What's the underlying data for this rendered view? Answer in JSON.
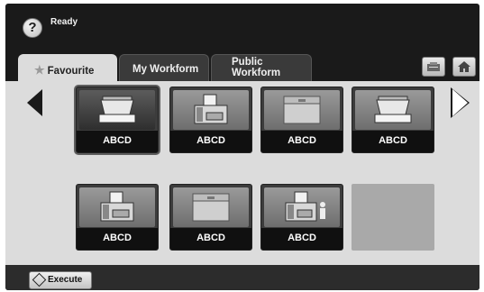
{
  "status": {
    "help_glyph": "?",
    "text": "Ready"
  },
  "tabs": [
    {
      "label": "Favourite",
      "active": true,
      "icon": "star-icon"
    },
    {
      "label": "My Workform",
      "active": false
    },
    {
      "label_line1": "Public",
      "label_line2": "Workform",
      "active": false
    }
  ],
  "header_buttons": {
    "report_icon": "report-icon",
    "home_icon": "home-icon"
  },
  "tiles": [
    {
      "label": "ABCD",
      "icon": "scanner-icon",
      "selected": true
    },
    {
      "label": "ABCD",
      "icon": "fax-icon",
      "selected": false
    },
    {
      "label": "ABCD",
      "icon": "folder-icon",
      "selected": false
    },
    {
      "label": "ABCD",
      "icon": "scanner-icon",
      "selected": false
    },
    {
      "label": "ABCD",
      "icon": "fax-icon",
      "selected": false
    },
    {
      "label": "ABCD",
      "icon": "folder-icon",
      "selected": false
    },
    {
      "label": "ABCD",
      "icon": "fax-user-icon",
      "selected": false
    }
  ],
  "execute": {
    "label": "Execute",
    "icon": "execute-icon"
  }
}
